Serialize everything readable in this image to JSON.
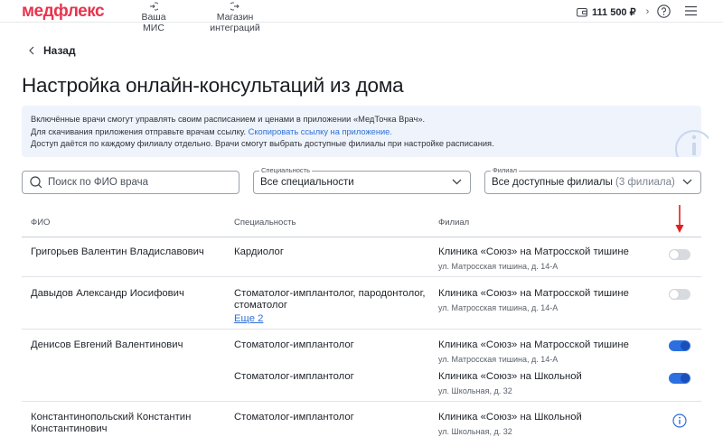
{
  "header": {
    "logo": "медфлекс",
    "nav": [
      {
        "label": "Ваша МИС",
        "icon": "arrow-in-circle-icon"
      },
      {
        "label": "Магазин интеграций",
        "icon": "arrow-out-circle-icon"
      }
    ],
    "balance": "111 500 ₽",
    "help_icon": "help-icon",
    "menu_icon": "hamburger-menu-icon"
  },
  "back_label": "Назад",
  "page_title": "Настройка онлайн-консультаций из дома",
  "info": {
    "line1": "Включённые врачи смогут управлять своим расписанием и ценами в приложении «МедТочка Врач».",
    "line2_prefix": "Для скачивания приложения отправьте врачам ссылку.",
    "line2_link": "Скопировать ссылку на приложение.",
    "line3": "Доступ даётся по каждому филиалу отдельно. Врачи смогут выбрать доступные филиалы при настройке расписания."
  },
  "filters": {
    "search_placeholder": "Поиск по ФИО врача",
    "specialty_label": "Специальность",
    "specialty_value": "Все специальности",
    "branch_label": "Филиал",
    "branch_value": "Все доступные филиалы",
    "branch_count": "(3 филиала)"
  },
  "table": {
    "columns": [
      "ФИО",
      "Специальность",
      "Филиал"
    ],
    "rows": [
      {
        "name": "Григорьев Валентин Владиславович",
        "entries": [
          {
            "specialty": "Кардиолог",
            "branch": "Клиника «Союз» на Матросской тишине",
            "address": "ул. Матросская тишина, д. 14-А",
            "enabled": false
          }
        ]
      },
      {
        "name": "Давыдов Александр Иосифович",
        "entries": [
          {
            "specialty_line1": "Стоматолог-имплантолог, пародонтолог,",
            "specialty_line2": "стоматолог",
            "more_link": "Еще 2",
            "branch": "Клиника «Союз» на Матросской тишине",
            "address": "ул. Матросская тишина, д. 14-А",
            "enabled": false
          }
        ]
      },
      {
        "name": "Денисов Евгений Валентинович",
        "entries": [
          {
            "specialty": "Стоматолог-имплантолог",
            "branch": "Клиника «Союз» на Матросской тишине",
            "address": "ул. Матросская тишина, д. 14-А",
            "enabled": true
          },
          {
            "specialty": "Стоматолог-имплантолог",
            "branch": "Клиника «Союз» на Школьной",
            "address": "ул. Школьная, д. 32",
            "enabled": true
          }
        ]
      },
      {
        "name_line1": "Константинопольский Константин",
        "name_line2": "Константинович",
        "entries": [
          {
            "specialty": "Стоматолог-имплантолог",
            "branch": "Клиника «Союз» на Школьной",
            "address": "ул. Школьная, д. 32",
            "status_icon": "info-icon"
          }
        ]
      }
    ]
  },
  "colors": {
    "brand": "#e8344e",
    "accent": "#2c6fe0",
    "info_bg": "#eef3fc",
    "annotation_arrow": "#e0201f"
  }
}
